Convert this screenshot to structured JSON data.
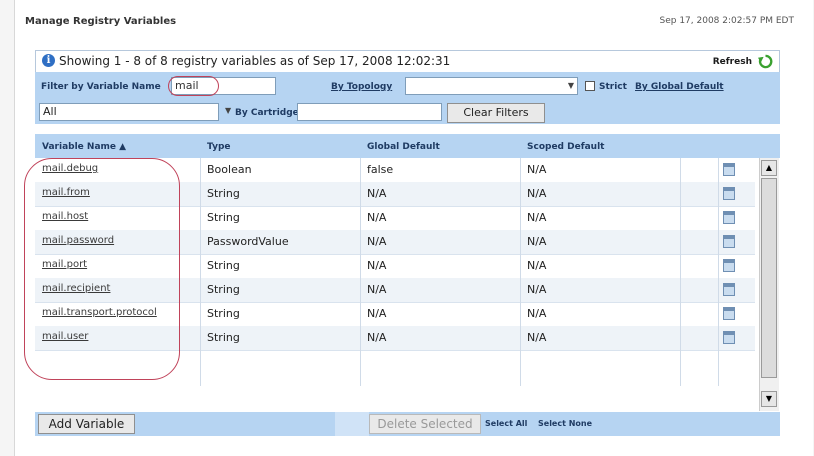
{
  "page": {
    "title": "Manage Registry Variables",
    "timestamp": "Sep 17, 2008 2:02:57 PM EDT"
  },
  "showing": {
    "text": "Showing 1 - 8  of 8 registry variables as of Sep 17, 2008 12:02:31",
    "refresh_label": "Refresh"
  },
  "filters": {
    "variable_name_label": "Filter by Variable Name",
    "variable_name_value": "mail",
    "by_topology_label": "By Topology",
    "topology_value": "",
    "strict_label": "Strict",
    "by_global_default_label": "By Global Default",
    "scope_value": "All",
    "by_cartridge_label": "By Cartridge",
    "cartridge_value": "",
    "clear_filters_label": "Clear Filters"
  },
  "columns": {
    "variable_name": "Variable Name ▲",
    "type": "Type",
    "global_default": "Global Default",
    "scoped_default": "Scoped Default"
  },
  "rows": [
    {
      "name": "mail.debug",
      "type": "Boolean",
      "global": "false",
      "scoped": "N/A"
    },
    {
      "name": "mail.from",
      "type": "String",
      "global": "N/A",
      "scoped": "N/A"
    },
    {
      "name": "mail.host",
      "type": "String",
      "global": "N/A",
      "scoped": "N/A"
    },
    {
      "name": "mail.password",
      "type": "PasswordValue",
      "global": "N/A",
      "scoped": "N/A"
    },
    {
      "name": "mail.port",
      "type": "String",
      "global": "N/A",
      "scoped": "N/A"
    },
    {
      "name": "mail.recipient",
      "type": "String",
      "global": "N/A",
      "scoped": "N/A"
    },
    {
      "name": "mail.transport.protocol",
      "type": "String",
      "global": "N/A",
      "scoped": "N/A"
    },
    {
      "name": "mail.user",
      "type": "String",
      "global": "N/A",
      "scoped": "N/A"
    }
  ],
  "footer": {
    "add_variable_label": "Add Variable",
    "delete_selected_label": "Delete Selected",
    "select_all_label": "Select All",
    "select_none_label": "Select None"
  },
  "colors": {
    "header_band": "#b6d4f2",
    "annotation_oval": "#c0435a",
    "link_text": "#1f3b63"
  },
  "icons": [
    "info-icon",
    "refresh-icon",
    "edit-icon",
    "copy-icon",
    "sort-ascending-icon",
    "scroll-up-icon",
    "scroll-down-icon"
  ]
}
